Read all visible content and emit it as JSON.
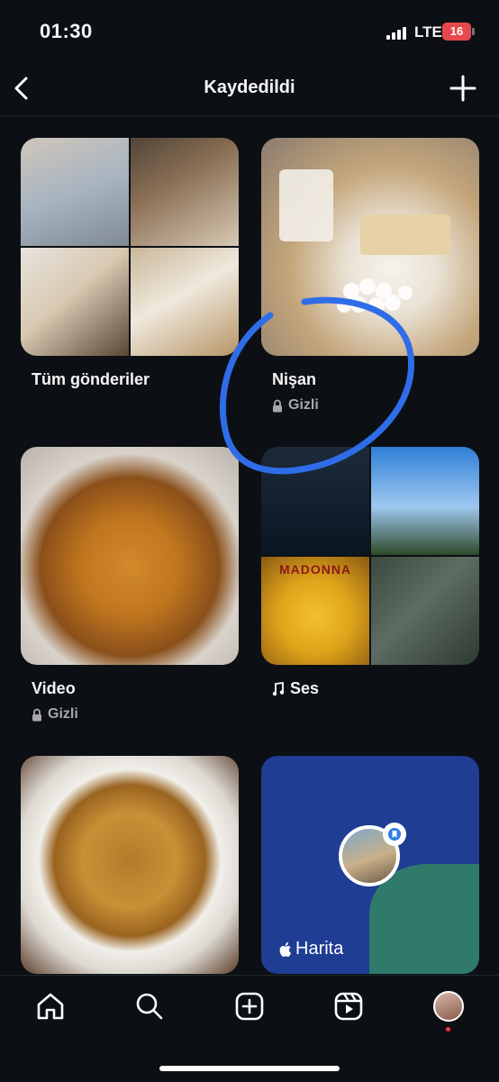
{
  "status_bar": {
    "time": "01:30",
    "network": "LTE",
    "battery": "16"
  },
  "header": {
    "title": "Kaydedildi",
    "back_icon": "chevron-left-icon",
    "add_icon": "plus-icon"
  },
  "collections": [
    {
      "name": "Tüm gönderiler",
      "private_label": ""
    },
    {
      "name": "Nişan",
      "private_label": "Gizli"
    },
    {
      "name": "Video",
      "private_label": "Gizli"
    },
    {
      "name": "Ses",
      "private_label": ""
    },
    {
      "name": "",
      "private_label": ""
    },
    {
      "name": "Harita",
      "private_label": ""
    }
  ],
  "album_art_text": "MADONNA",
  "colors": {
    "background": "#0c1014",
    "annotation": "#2f6de8",
    "badge_blue": "#2b7de9",
    "map_water": "#1f3d93"
  },
  "bottom_nav": [
    {
      "icon": "home-icon"
    },
    {
      "icon": "search-icon"
    },
    {
      "icon": "create-icon"
    },
    {
      "icon": "reels-icon"
    },
    {
      "icon": "profile-avatar"
    }
  ]
}
